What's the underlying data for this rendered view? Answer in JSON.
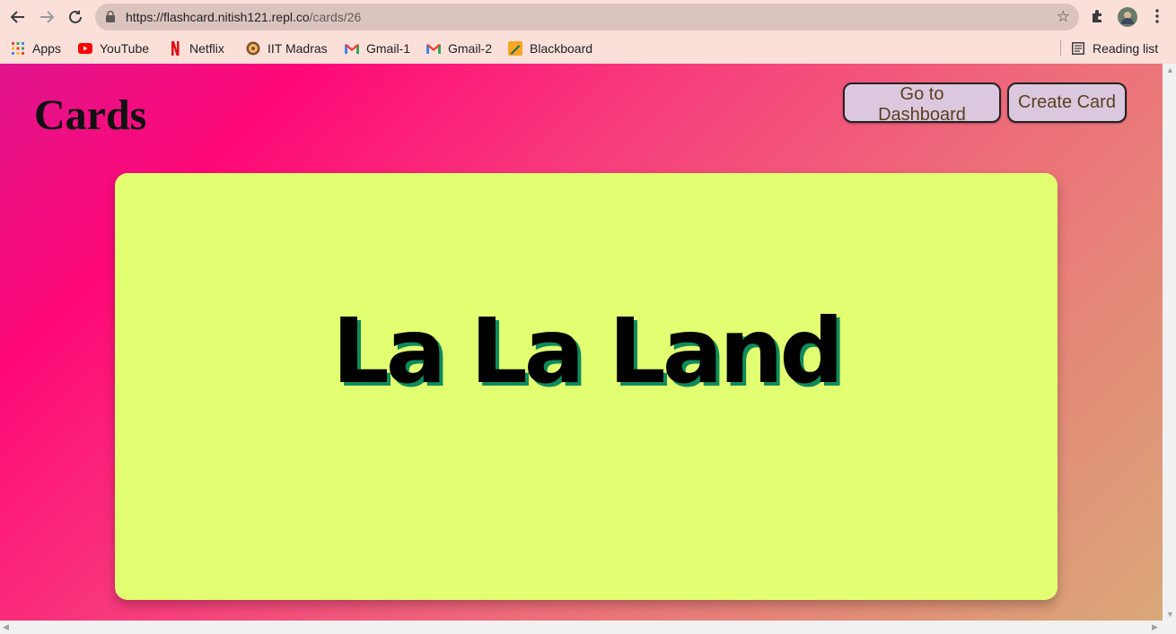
{
  "browser": {
    "url_host": "https://flashcard.nitish121.repl.co",
    "url_path": "/cards/26",
    "bookmarks": [
      {
        "label": "Apps",
        "icon": "apps-grid-icon"
      },
      {
        "label": "YouTube",
        "icon": "youtube-icon"
      },
      {
        "label": "Netflix",
        "icon": "netflix-icon"
      },
      {
        "label": "IIT Madras",
        "icon": "iit-madras-icon"
      },
      {
        "label": "Gmail-1",
        "icon": "gmail-icon"
      },
      {
        "label": "Gmail-2",
        "icon": "gmail-icon"
      },
      {
        "label": "Blackboard",
        "icon": "blackboard-icon"
      }
    ],
    "reading_list_label": "Reading list"
  },
  "page": {
    "title": "Cards",
    "dashboard_button": "Go to Dashboard",
    "create_button": "Create Card",
    "card_text": "La La Land"
  },
  "colors": {
    "card_bg": "#e2ff72",
    "text_shadow": "#0f8a5c",
    "button_bg": "#dcc8de"
  }
}
